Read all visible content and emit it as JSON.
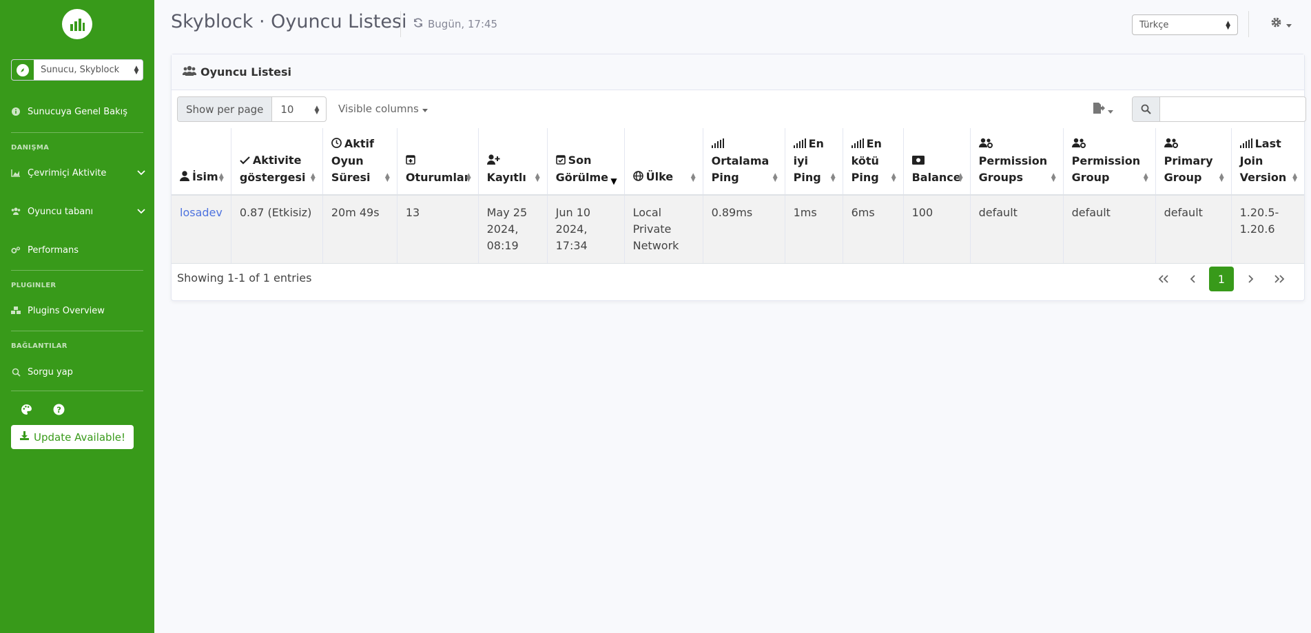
{
  "sidebar": {
    "server_select": "Sunucu, Skyblock",
    "overview": "Sunucuya Genel Bakış",
    "section_analysis": "DANIŞMA",
    "online_activity": "Çevrimiçi Aktivite",
    "player_base": "Oyuncu tabanı",
    "performance": "Performans",
    "section_plugins": "PLUGINLER",
    "plugins_overview": "Plugins Overview",
    "section_links": "BAĞLANTILAR",
    "query": "Sorgu yap",
    "update": "Update Available!"
  },
  "header": {
    "title": "Skyblock · Oyuncu Listesi",
    "refresh": "Bugün, 17:45",
    "language": "Türkçe"
  },
  "card": {
    "title": "Oyuncu Listesi",
    "show_per_page": "Show per page",
    "per_page_value": "10",
    "visible_columns": "Visible columns",
    "search_placeholder": "",
    "footer": "Showing 1-1 of 1 entries",
    "current_page": "1"
  },
  "table": {
    "headers": [
      "İsim",
      "Aktivite göstergesi",
      "Aktif Oyun Süresi",
      "Oturumlar",
      "Kayıtlı",
      "Son Görülme",
      "Ülke",
      "Ortalama Ping",
      "En iyi Ping",
      "En kötü Ping",
      "Balance",
      "Permission Groups",
      "Permission Group",
      "Primary Group",
      "Last Join Version"
    ],
    "row": [
      "losadev",
      "0.87 (Etkisiz)",
      "20m 49s",
      "13",
      "May 25 2024, 08:19",
      "Jun 10 2024, 17:34",
      "Local Private Network",
      "0.89ms",
      "1ms",
      "6ms",
      "100",
      "default",
      "default",
      "default",
      "1.20.5-1.20.6"
    ]
  },
  "colors": {
    "brand": "#389a1a",
    "link": "#4e73df"
  }
}
